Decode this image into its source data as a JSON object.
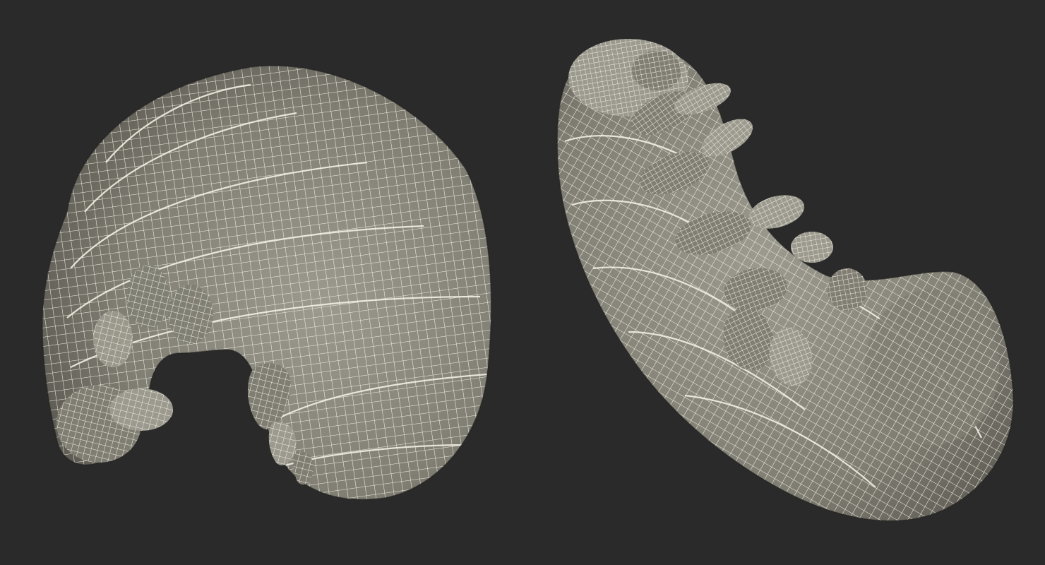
{
  "scene": {
    "background_color": "#2a2a2a",
    "mesh_fill_color": "#807e73",
    "mesh_fill_light": "#9c9a8e",
    "mesh_fill_dark": "#5f5d55",
    "wire_color": "#f2efe3",
    "views": [
      {
        "subject": "grub-larva-wireframe-side-view",
        "pose": "curled"
      },
      {
        "subject": "grub-larva-wireframe-underside-view",
        "pose": "legs-up"
      }
    ]
  }
}
